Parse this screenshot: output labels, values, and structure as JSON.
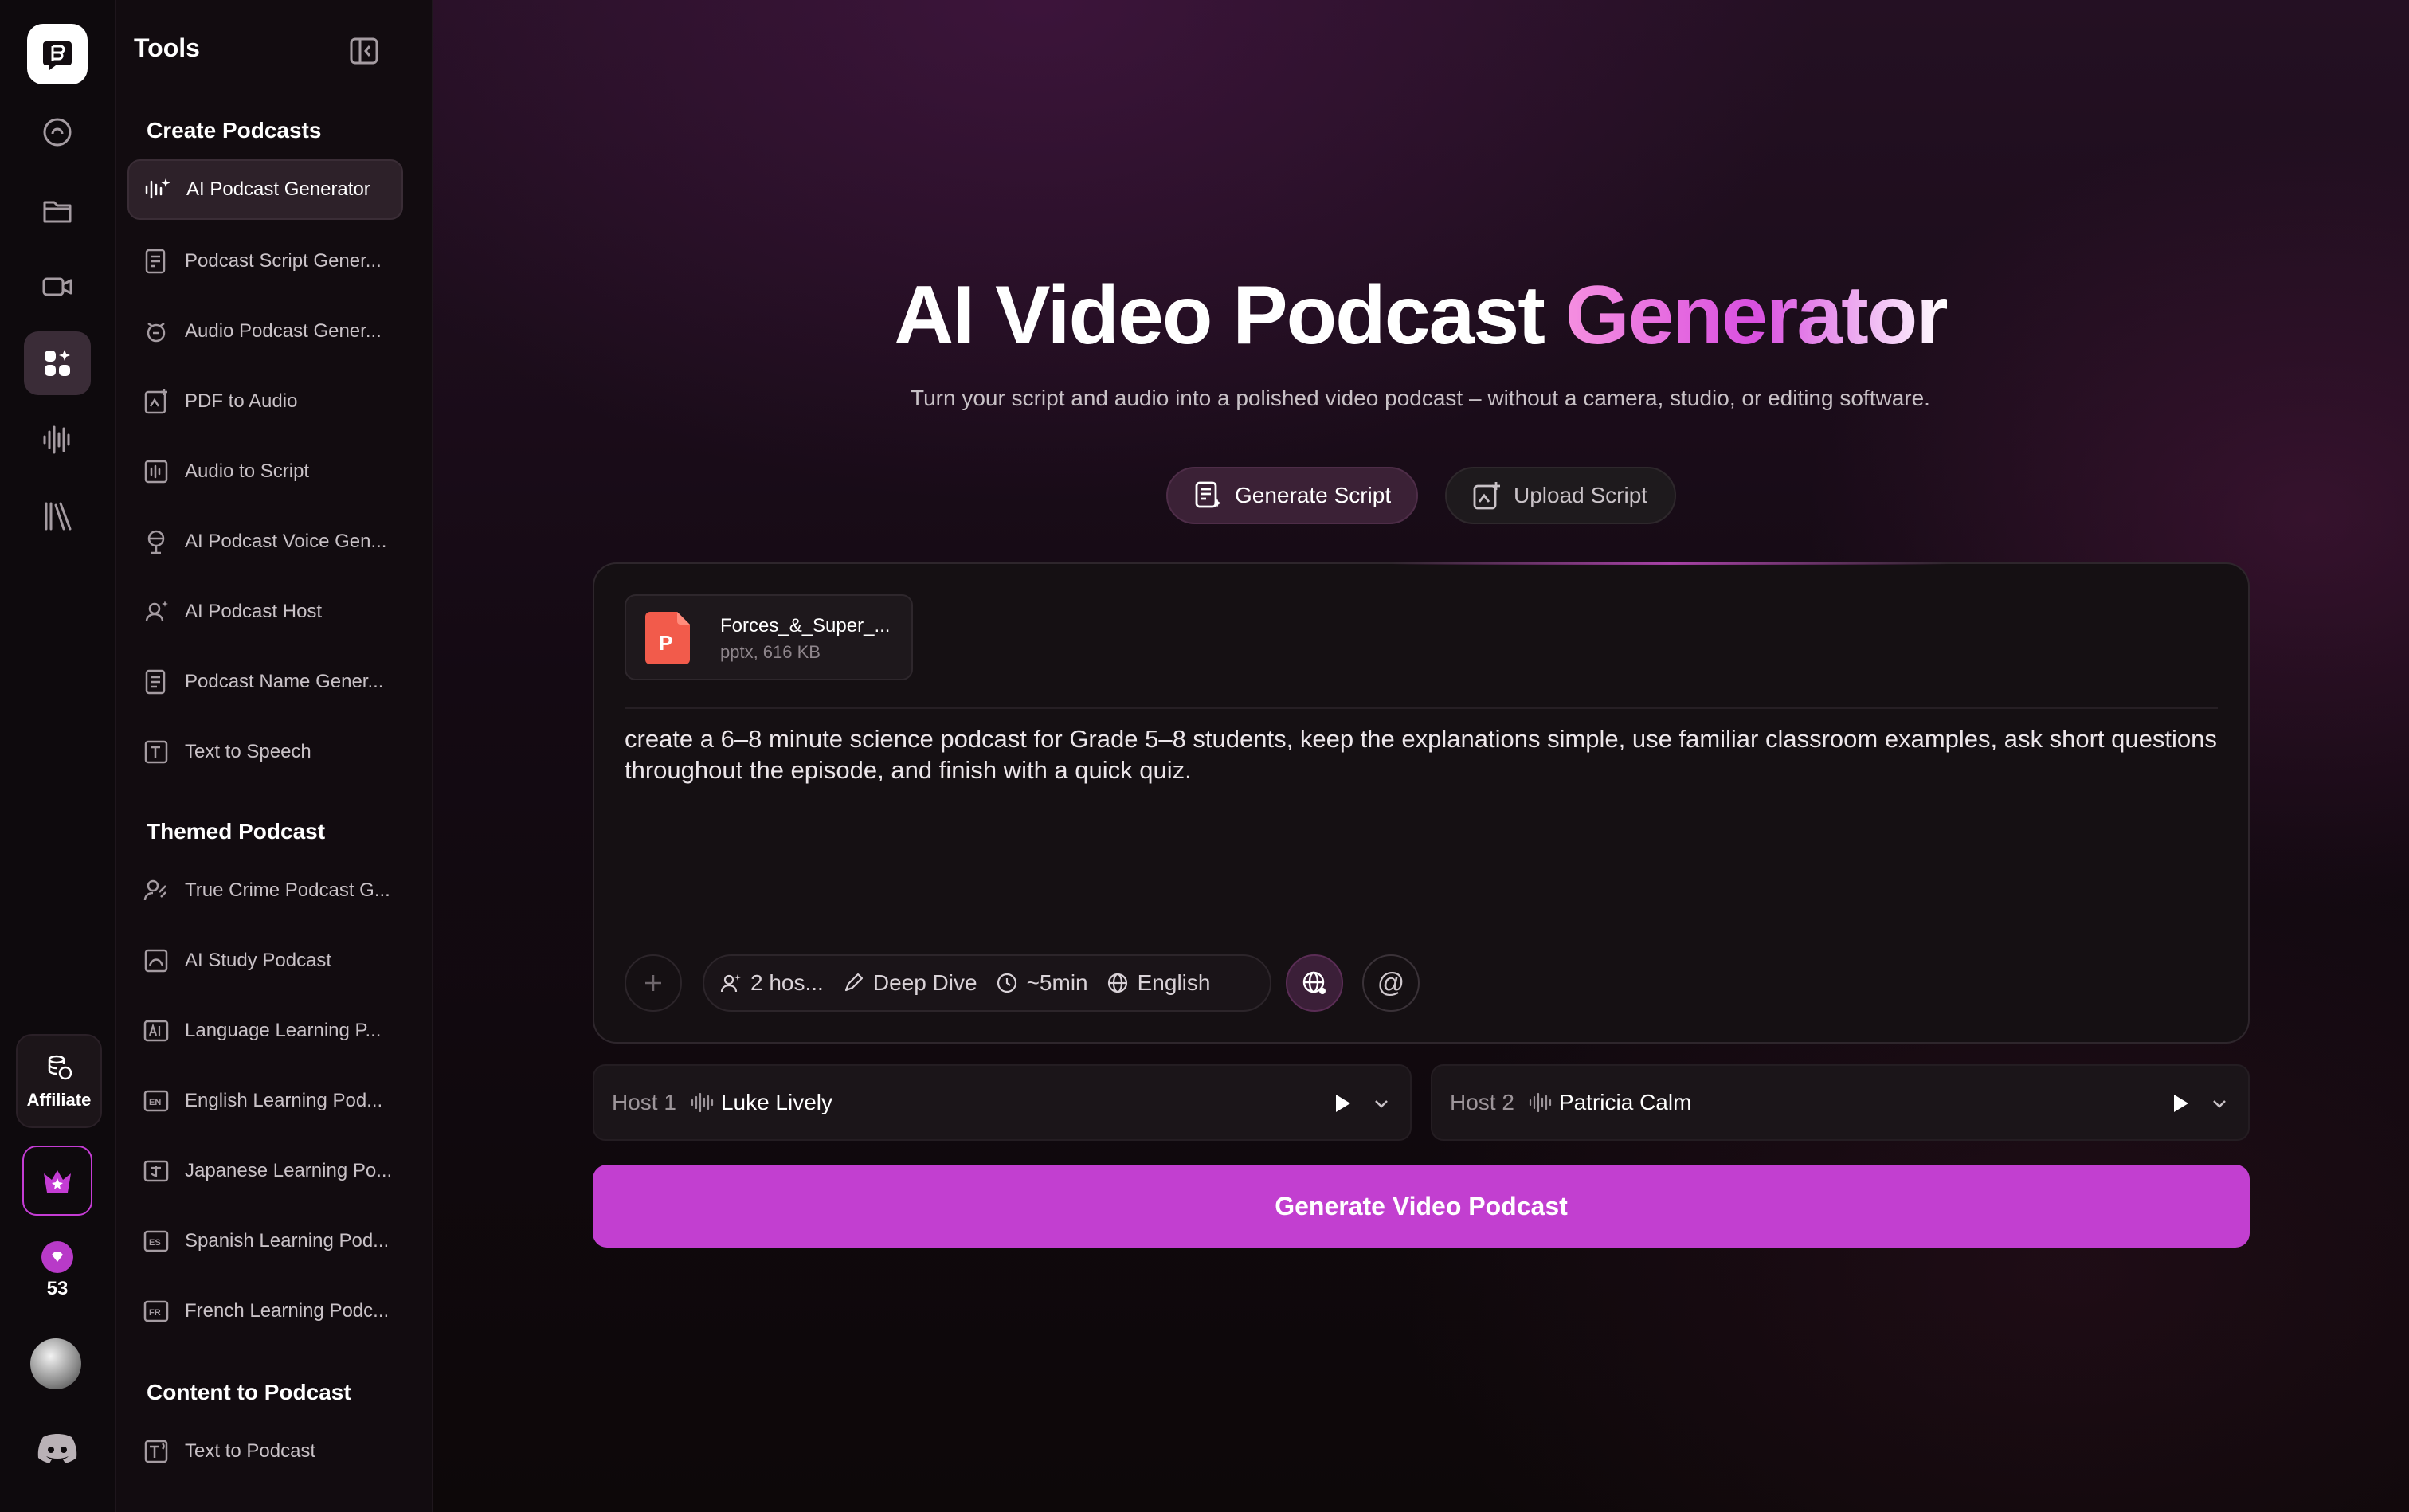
{
  "rail": {
    "items": [
      {
        "name": "explore-icon"
      },
      {
        "name": "folder-icon"
      },
      {
        "name": "video-icon"
      },
      {
        "name": "tools-grid-icon",
        "active": true
      },
      {
        "name": "audio-wave-icon"
      },
      {
        "name": "library-icon"
      }
    ],
    "affiliate_label": "Affiliate",
    "credits": "53"
  },
  "tools": {
    "title": "Tools",
    "sections": [
      {
        "title": "Create Podcasts",
        "items": [
          {
            "label": "AI Podcast Generator",
            "icon": "sparkle-wave-icon",
            "active": true
          },
          {
            "label": "Podcast Script Gener...",
            "icon": "script-icon"
          },
          {
            "label": "Audio Podcast Gener...",
            "icon": "audio-podcast-icon"
          },
          {
            "label": "PDF to Audio",
            "icon": "pdf-icon"
          },
          {
            "label": "Audio to Script",
            "icon": "audio-script-icon"
          },
          {
            "label": "AI Podcast Voice Gen...",
            "icon": "microphone-icon"
          },
          {
            "label": "AI Podcast Host",
            "icon": "host-icon"
          },
          {
            "label": "Podcast Name Gener...",
            "icon": "name-icon"
          },
          {
            "label": "Text to Speech",
            "icon": "text-speech-icon"
          }
        ]
      },
      {
        "title": "Themed Podcast",
        "items": [
          {
            "label": "True Crime Podcast G...",
            "icon": "true-crime-icon"
          },
          {
            "label": "AI Study Podcast",
            "icon": "study-icon"
          },
          {
            "label": "Language Learning P...",
            "icon": "language-icon"
          },
          {
            "label": "English Learning Pod...",
            "icon": "english-icon"
          },
          {
            "label": "Japanese Learning Po...",
            "icon": "japanese-icon"
          },
          {
            "label": "Spanish Learning Pod...",
            "icon": "spanish-icon"
          },
          {
            "label": "French Learning Podc...",
            "icon": "french-icon"
          }
        ]
      },
      {
        "title": "Content to Podcast",
        "items": [
          {
            "label": "Text to Podcast",
            "icon": "text-podcast-icon"
          }
        ]
      }
    ]
  },
  "main": {
    "title_part1": "AI Video Podcast ",
    "title_part2": "Generator",
    "subtitle": "Turn your script and audio into a polished video podcast – without a camera, studio, or editing software.",
    "tabs": [
      {
        "label": "Generate Script",
        "active": true
      },
      {
        "label": "Upload Script",
        "active": false
      }
    ],
    "file": {
      "badge": "P",
      "name": "Forces_&_Super_...",
      "meta": "pptx, 616 KB"
    },
    "prompt": "create a 6–8 minute science podcast for Grade 5–8 students, keep the explanations simple, use familiar classroom examples, ask short questions throughout the episode, and finish with a quick quiz.",
    "options": {
      "hosts": "2 hos...",
      "style": "Deep Dive",
      "duration": "~5min",
      "language": "English"
    },
    "at_symbol": "@",
    "hosts": [
      {
        "label": "Host 1",
        "voice": "Luke Lively"
      },
      {
        "label": "Host 2",
        "voice": "Patricia Calm"
      }
    ],
    "generate_label": "Generate Video Podcast"
  },
  "colors": {
    "accent": "#c23fd0",
    "background": "#140a13",
    "panel": "#151013"
  }
}
